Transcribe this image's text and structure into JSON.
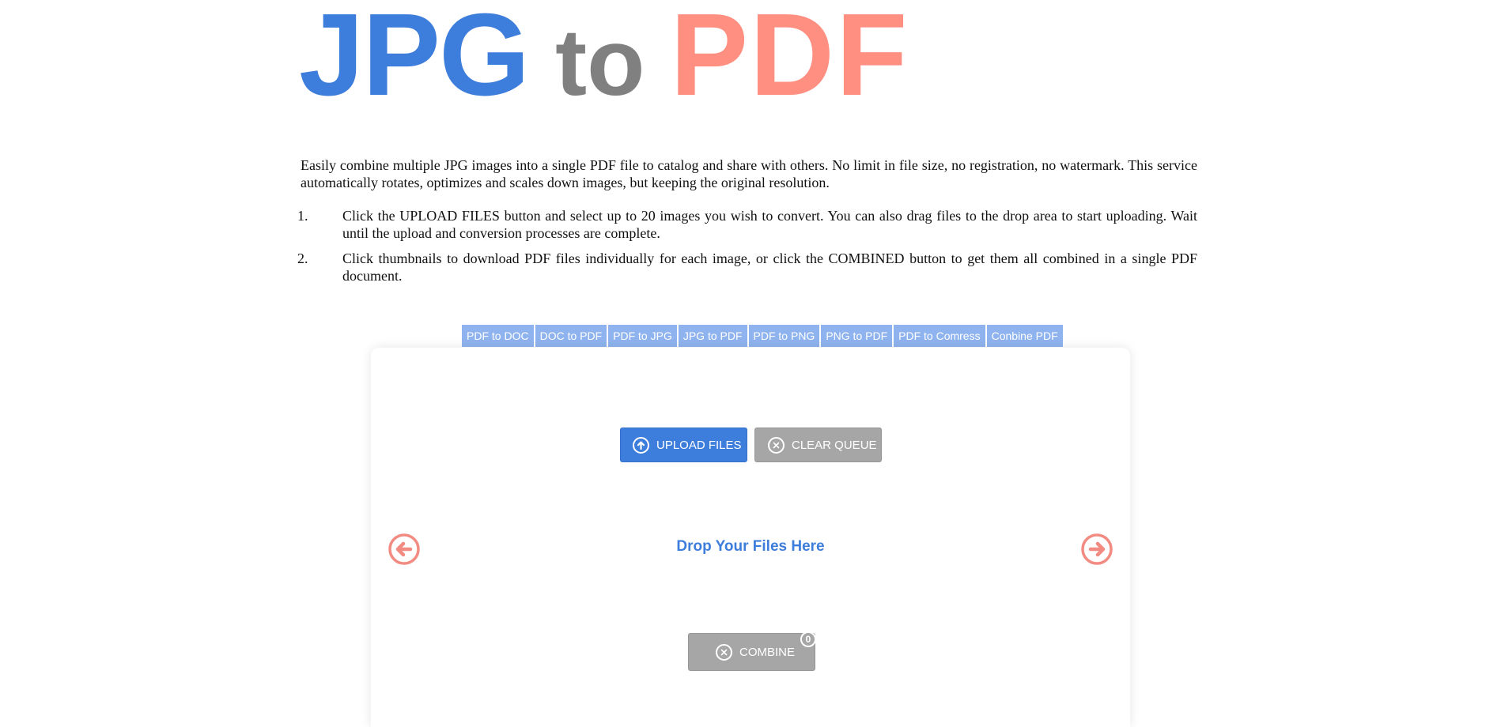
{
  "logo": {
    "word1": "JPG",
    "word2": "to",
    "word3": "PDF",
    "colors": {
      "word1": "#3d7ddb",
      "word2": "#808080",
      "word3": "#ff8f80"
    }
  },
  "intro": "Easily combine multiple JPG images into a single PDF file to catalog and share with others. No limit in file size, no registration, no watermark. This service automatically rotates, optimizes and scales down images, but keeping the original resolution.",
  "steps": [
    {
      "number": "1.",
      "text": "Click the UPLOAD FILES button and select up to 20 images you wish to convert. You can also drag files to the drop area to start uploading. Wait until the upload and conversion processes are complete."
    },
    {
      "number": "2.",
      "text": "Click thumbnails to download PDF files individually for each image, or click the COMBINED button to get them all combined in a single PDF document."
    }
  ],
  "tabs": [
    "PDF to DOC",
    "DOC to PDF",
    "PDF to JPG",
    "JPG to PDF",
    "PDF to PNG",
    "PNG to PDF",
    "PDF to Comress",
    "Conbine PDF"
  ],
  "panel": {
    "upload_label": "UPLOAD FILES",
    "upload_icon": "arrow-up-circle-icon",
    "clear_label": "CLEAR QUEUE",
    "clear_icon": "x-circle-icon",
    "drop_text": "Drop Your Files Here",
    "prev_icon": "arrow-left-circle-icon",
    "next_icon": "arrow-right-circle-icon",
    "combine_label": "COMBINE",
    "combine_icon": "x-circle-icon",
    "combine_count": "0"
  },
  "colors": {
    "accent_blue": "#3d7ddb",
    "tab_blue": "#8fb3ee",
    "button_gray": "#a6a6a6",
    "arrow_salmon": "#f28b82"
  }
}
